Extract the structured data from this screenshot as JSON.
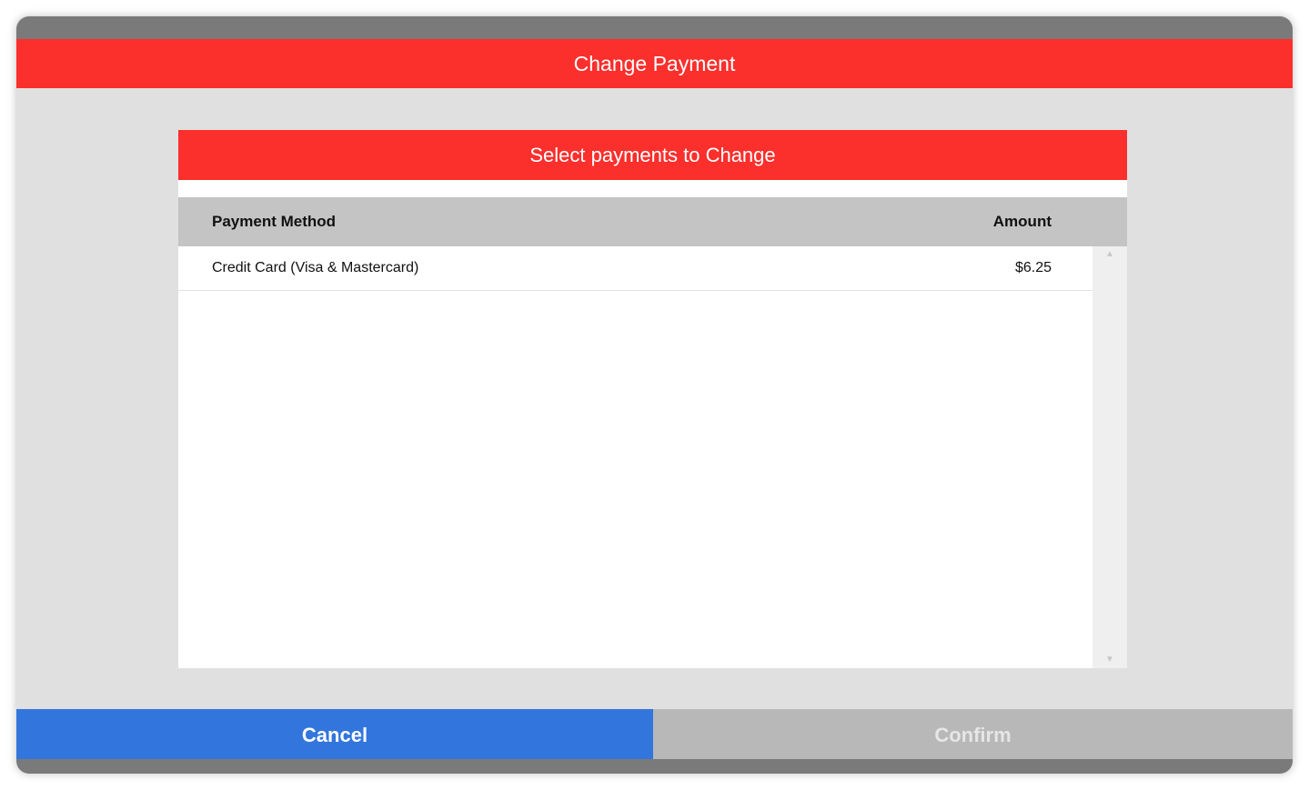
{
  "dialog": {
    "title": "Change Payment"
  },
  "panel": {
    "header": "Select payments to Change",
    "columns": {
      "method": "Payment Method",
      "amount": "Amount"
    },
    "rows": [
      {
        "method": "Credit Card (Visa & Mastercard)",
        "amount": "$6.25"
      }
    ],
    "scroll_up_icon": "chevron-up-icon",
    "scroll_down_icon": "chevron-down-icon"
  },
  "footer": {
    "cancel_label": "Cancel",
    "confirm_label": "Confirm"
  },
  "colors": {
    "accent_red": "#fb2f2c",
    "cancel_blue": "#3276dd",
    "confirm_disabled": "#b8b8b8",
    "frame_gray": "#7a7a7a"
  }
}
